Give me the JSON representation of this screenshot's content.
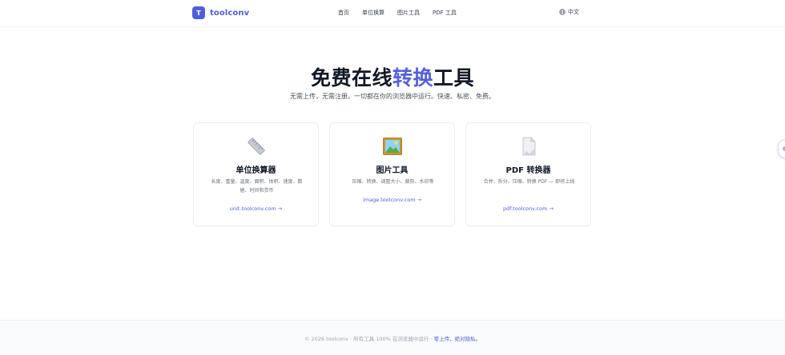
{
  "header": {
    "logo_mark": "T",
    "logo_text": "toolconv",
    "nav": [
      "首页",
      "单位换算",
      "图片工具",
      "PDF 工具"
    ],
    "language": "中文"
  },
  "hero": {
    "title_before": "免费在线",
    "title_accent": "转换",
    "title_after": "工具",
    "subtitle": "无需上传，无需注册。一切都在你的浏览器中运行。快速、私密、免费。"
  },
  "cards": [
    {
      "icon": "ruler-icon",
      "title": "单位换算器",
      "description": "长度、重量、温度、面积、体积、速度、数据、时间和货币",
      "link": "unit.toolconv.com →"
    },
    {
      "icon": "framed-picture-icon",
      "title": "图片工具",
      "description": "压缩、转换、调整大小、裁剪、水印等",
      "link": "image.toolconv.com →"
    },
    {
      "icon": "document-icon",
      "title": "PDF 转换器",
      "description": "合并、拆分、压缩、转换 PDF — 即将上线",
      "link": "pdf.toolconv.com →"
    }
  ],
  "footer": {
    "text": "© 2026 toolconv · 所有工具 100% 在浏览器中运行 · ",
    "emphasis": "零上传，绝对隐私。"
  },
  "colors": {
    "accent": "#4f5fd8",
    "text": "#111827",
    "muted": "#6b7280"
  }
}
